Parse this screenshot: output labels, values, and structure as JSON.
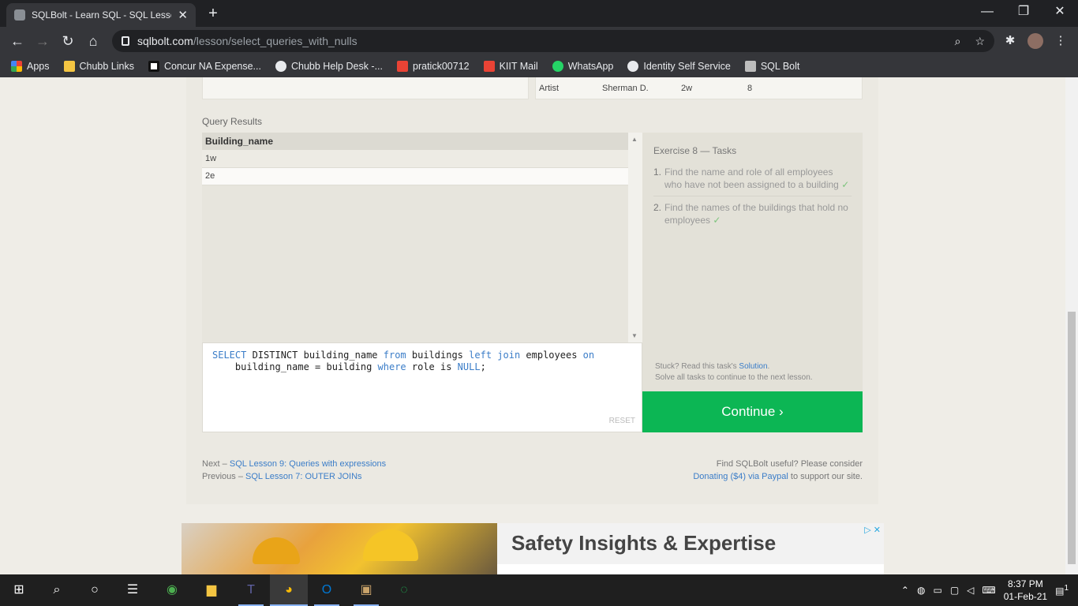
{
  "browser": {
    "tab_title": "SQLBolt - Learn SQL - SQL Lesso",
    "url_domain": "sqlbolt.com",
    "url_path": "/lesson/select_queries_with_nulls",
    "new_tab": "+",
    "close_tab": "✕",
    "minimize": "—",
    "restore": "❐",
    "close": "✕"
  },
  "bookmarks": [
    {
      "label": "Apps",
      "icon": "apps-grid-icon",
      "color": "#e8453c"
    },
    {
      "label": "Chubb Links",
      "icon": "folder-icon",
      "color": "#f4c542"
    },
    {
      "label": "Concur NA Expense...",
      "icon": "concur-icon",
      "color": "#ffffff"
    },
    {
      "label": "Chubb Help Desk -...",
      "icon": "globe-icon",
      "color": "#e8eaed"
    },
    {
      "label": "pratick00712",
      "icon": "gmail-icon",
      "color": "#ea4335"
    },
    {
      "label": "KIIT Mail",
      "icon": "gmail-icon",
      "color": "#ea4335"
    },
    {
      "label": "WhatsApp",
      "icon": "whatsapp-icon",
      "color": "#25d366"
    },
    {
      "label": "Identity Self Service",
      "icon": "globe-icon",
      "color": "#e8eaed"
    },
    {
      "label": "SQL Bolt",
      "icon": "database-icon",
      "color": "#bdbdbd"
    }
  ],
  "top_table_row": {
    "role": "Artist",
    "name": "Sherman D.",
    "building": "2w",
    "years": "8"
  },
  "query_results": {
    "label": "Query Results",
    "header": "Building_name",
    "rows": [
      "1w",
      "2e"
    ]
  },
  "editor": {
    "line1": [
      "SELECT",
      " DISTINCT building_name ",
      "from",
      " buildings ",
      "left",
      " ",
      "join",
      " employees ",
      "on"
    ],
    "line2": [
      "    building_name = building ",
      "where",
      " role is ",
      "NULL",
      ";"
    ],
    "reset": "RESET"
  },
  "tasks": {
    "title": "Exercise 8 — Tasks",
    "items": [
      {
        "num": "1.",
        "text": "Find the name and role of all employees who have not been assigned to a building",
        "check": "✓"
      },
      {
        "num": "2.",
        "text": "Find the names of the buildings that hold no employees",
        "check": "✓"
      }
    ],
    "stuck_prefix": "Stuck? Read this task's ",
    "stuck_link": "Solution",
    "stuck_suffix": ".",
    "solve_all": "Solve all tasks to continue to the next lesson."
  },
  "continue_label": "Continue ›",
  "footer": {
    "next_prefix": "Next – ",
    "next_link": "SQL Lesson 9: Queries with expressions",
    "prev_prefix": "Previous – ",
    "prev_link": "SQL Lesson 7: OUTER JOINs",
    "useful": "Find SQLBolt useful? Please consider",
    "donate_link": "Donating ($4) via Paypal",
    "donate_suffix": " to support our site."
  },
  "ad": {
    "title": "Safety Insights & Expertise",
    "choices": "▷ ✕"
  },
  "taskbar": {
    "time": "8:37 PM",
    "date": "01-Feb-21",
    "notification_count": "1"
  },
  "colors": {
    "accent_green": "#0cb654",
    "link_blue": "#3b7dc8"
  }
}
